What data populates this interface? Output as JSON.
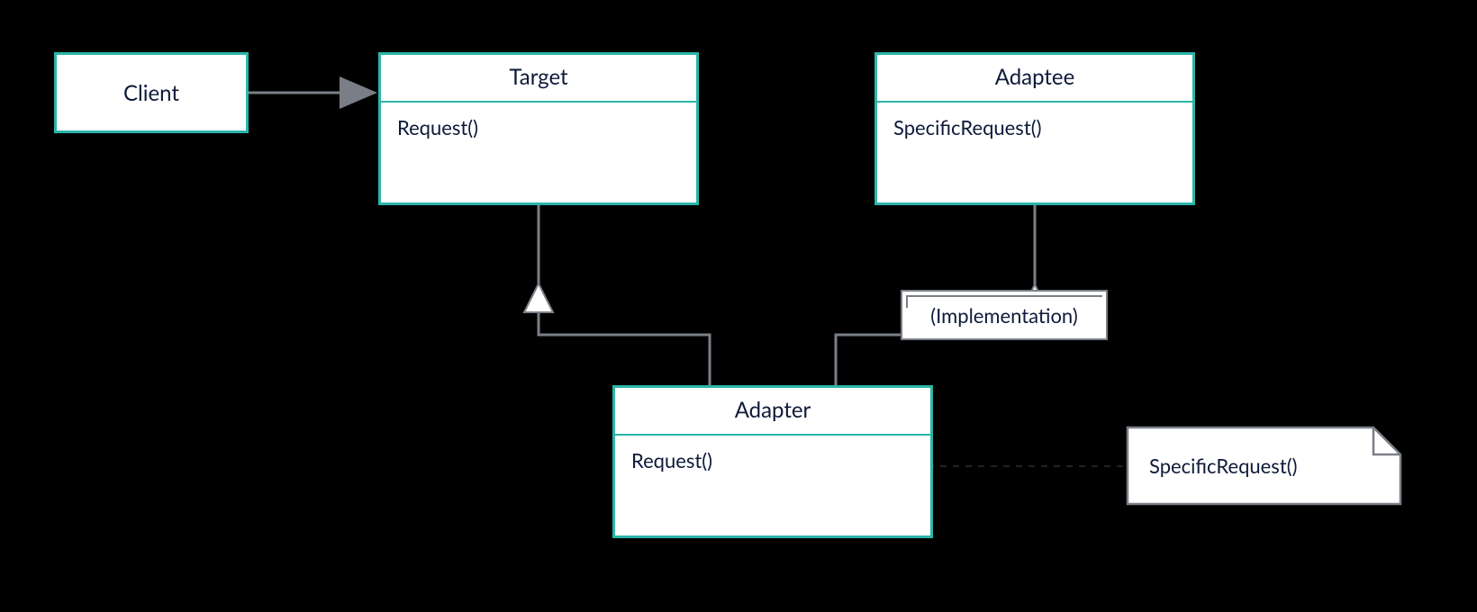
{
  "classes": {
    "client": {
      "title": "Client"
    },
    "target": {
      "title": "Target",
      "method": "Request()"
    },
    "adaptee": {
      "title": "Adaptee",
      "method": "SpecificRequest()"
    },
    "adapter": {
      "title": "Adapter",
      "method": "Request()"
    }
  },
  "labels": {
    "implementation": "(Implementation)",
    "note": "SpecificRequest()"
  },
  "colors": {
    "accent": "#2bb5a9",
    "line": "#7a7f87",
    "text": "#0e1a3a"
  }
}
